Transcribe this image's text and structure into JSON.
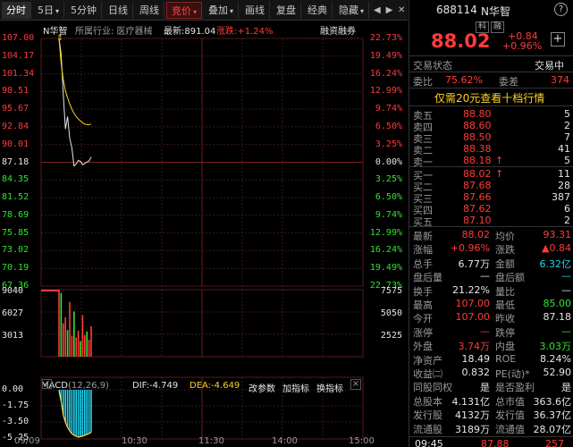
{
  "toolbar": {
    "tabs": [
      "分时",
      "5日",
      "5分钟",
      "日线",
      "周线",
      "竞价",
      "叠加",
      "画线",
      "复盘",
      "经典",
      "隐藏"
    ],
    "active": "分时",
    "selected": "竞价"
  },
  "chart_header": {
    "name": "N华智",
    "industry": "所属行业: 医疗器械",
    "latest": "最新:891.04",
    "change": "涨跌:+1.24%",
    "margin": "融资融券"
  },
  "price_axis": {
    "left": [
      "107.00",
      "104.17",
      "101.34",
      "98.51",
      "95.67",
      "92.84",
      "90.01",
      "87.18",
      "84.35",
      "81.52",
      "78.69",
      "75.85",
      "73.02",
      "70.19",
      "67.36"
    ],
    "right": [
      "22.73%",
      "19.49%",
      "16.24%",
      "12.99%",
      "9.74%",
      "6.50%",
      "3.25%",
      "0.00%",
      "3.25%",
      "6.50%",
      "9.74%",
      "12.99%",
      "16.24%",
      "19.49%",
      "22.73%"
    ]
  },
  "volume_axis": {
    "left": [
      "9040",
      "6027",
      "3013"
    ],
    "right": [
      "7575",
      "5050",
      "2525"
    ]
  },
  "macd_header": {
    "label": "MACD",
    "params": "(12,26,9)",
    "dif": "DIF:-4.749",
    "dea": "DEA:-4.649",
    "links": [
      "改参数",
      "加指标",
      "换指标"
    ]
  },
  "macd_axis": [
    "0.00",
    "-1.75",
    "-3.50",
    "-5.25"
  ],
  "time_axis": [
    "09/09",
    "10:30",
    "11:30",
    "14:00",
    "15:00"
  ],
  "chart_data": {
    "type": "line",
    "x": [
      "09:30",
      "09:31",
      "09:32",
      "09:33",
      "09:34",
      "09:35",
      "09:36",
      "09:37",
      "09:38",
      "09:39",
      "09:40",
      "09:41",
      "09:42",
      "09:43",
      "09:44",
      "09:45"
    ],
    "series": [
      {
        "name": "price",
        "values": [
          107.0,
          104.5,
          98.0,
          92.5,
          94.5,
          91.0,
          89.5,
          86.6,
          86.9,
          87.5,
          87.3,
          86.8,
          87.0,
          87.2,
          87.4,
          88.02
        ]
      },
      {
        "name": "avg",
        "values": [
          107.0,
          103.0,
          100.4,
          98.6,
          97.5,
          96.5,
          95.7,
          95.0,
          94.5,
          94.1,
          93.8,
          93.5,
          93.3,
          93.2,
          93.2,
          93.31
        ]
      }
    ],
    "volume": [
      9040,
      8600,
      4500,
      5300,
      3600,
      7400,
      2800,
      6100,
      2600,
      3500,
      2100,
      5600,
      2900,
      3400,
      2300,
      4100
    ],
    "macd": [
      0.0,
      -1.2,
      -2.8,
      -3.6,
      -4.2,
      -4.6,
      -4.9,
      -5.1,
      -5.2,
      -5.3,
      -5.25,
      -5.2,
      -5.1,
      -5.0,
      -4.9,
      -4.75
    ],
    "ylim": [
      67.36,
      107.0
    ],
    "prev_close": 87.18
  },
  "quote": {
    "code": "688114",
    "name": "N华智",
    "badges": [
      "科",
      "融"
    ],
    "price": "88.02",
    "change": "+0.84",
    "change_pct": "+0.96%",
    "plus": "+"
  },
  "status": {
    "label": "交易状态",
    "value": "交易中"
  },
  "webi": {
    "label": "委比",
    "value": "75.62%",
    "label2": "委差",
    "value2": "374"
  },
  "promo": "仅需20元查看十档行情",
  "asks": [
    {
      "label": "卖五",
      "price": "88.80",
      "vol": "5"
    },
    {
      "label": "卖四",
      "price": "88.60",
      "vol": "2"
    },
    {
      "label": "卖三",
      "price": "88.50",
      "vol": "7"
    },
    {
      "label": "卖二",
      "price": "88.38",
      "vol": "41"
    },
    {
      "label": "卖一",
      "price": "88.18",
      "vol": "5",
      "arrow": "↑"
    }
  ],
  "bids": [
    {
      "label": "买一",
      "price": "88.02",
      "vol": "11",
      "arrow": "↑"
    },
    {
      "label": "买二",
      "price": "87.68",
      "vol": "28"
    },
    {
      "label": "买三",
      "price": "87.66",
      "vol": "387"
    },
    {
      "label": "买四",
      "price": "87.62",
      "vol": "6"
    },
    {
      "label": "买五",
      "price": "87.10",
      "vol": "2"
    }
  ],
  "stats": [
    {
      "l1": "最新",
      "v1": "88.02",
      "c1": "red",
      "l2": "均价",
      "v2": "93.31",
      "c2": "red"
    },
    {
      "l1": "涨幅",
      "v1": "+0.96%",
      "c1": "red",
      "l2": "涨跌",
      "v2": "▲0.84",
      "c2": "red"
    },
    {
      "l1": "总手",
      "v1": "6.77万",
      "c1": "white",
      "l2": "金额",
      "v2": "6.32亿",
      "c2": "cyan"
    },
    {
      "l1": "盘后量",
      "v1": "—",
      "c1": "white",
      "l2": "盘后额",
      "v2": "—",
      "c2": "cyan"
    },
    {
      "l1": "换手",
      "v1": "21.22%",
      "c1": "white",
      "l2": "量比",
      "v2": "—",
      "c2": "white"
    },
    {
      "l1": "最高",
      "v1": "107.00",
      "c1": "red",
      "l2": "最低",
      "v2": "85.00",
      "c2": "green"
    },
    {
      "l1": "今开",
      "v1": "107.00",
      "c1": "red",
      "l2": "昨收",
      "v2": "87.18",
      "c2": "white"
    },
    {
      "l1": "涨停",
      "v1": "—",
      "c1": "red",
      "l2": "跌停",
      "v2": "—",
      "c2": "green"
    },
    {
      "l1": "外盘",
      "v1": "3.74万",
      "c1": "red",
      "l2": "内盘",
      "v2": "3.03万",
      "c2": "green"
    },
    {
      "l1": "净资产",
      "v1": "18.49",
      "c1": "white",
      "l2": "ROE",
      "v2": "8.24%",
      "c2": "white"
    },
    {
      "l1": "收益㈡",
      "v1": "0.832",
      "c1": "white",
      "l2": "PE(动)*",
      "v2": "52.90",
      "c2": "white"
    },
    {
      "l1": "同股同权",
      "v1": "是",
      "c1": "white",
      "l2": "是否盈利",
      "v2": "是",
      "c2": "white"
    },
    {
      "l1": "总股本",
      "v1": "4.131亿",
      "c1": "white",
      "l2": "总市值",
      "v2": "363.6亿",
      "c2": "white"
    },
    {
      "l1": "发行股",
      "v1": "4132万",
      "c1": "white",
      "l2": "发行值",
      "v2": "36.37亿",
      "c2": "white"
    },
    {
      "l1": "流通股",
      "v1": "3189万",
      "c1": "white",
      "l2": "流通值",
      "v2": "28.07亿",
      "c2": "white"
    }
  ],
  "tick": {
    "time": "09:45",
    "price": "87.88",
    "vol": "257"
  },
  "colors": {
    "up": "#ff3b3b",
    "down": "#2ee62e",
    "avg": "#ffd21e",
    "price_line": "#e6e6e6",
    "grid": "#3a1a1a"
  }
}
